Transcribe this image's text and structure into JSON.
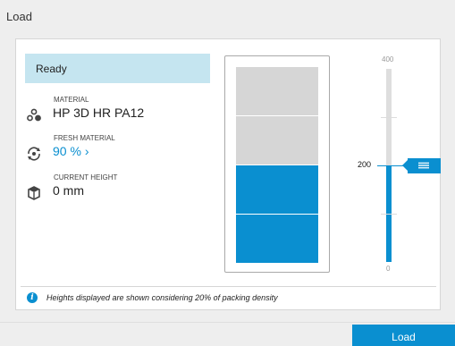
{
  "window": {
    "title": "Load"
  },
  "status": {
    "label": "Ready",
    "color": "#c5e5f0"
  },
  "material": {
    "label": "MATERIAL",
    "value": "HP 3D HR PA12",
    "icon": "material-icon"
  },
  "fresh_material": {
    "label": "FRESH MATERIAL",
    "value": "90 %",
    "chevron": "›",
    "icon": "fresh-material-icon"
  },
  "current_height": {
    "label": "CURRENT HEIGHT",
    "value": "0 mm",
    "icon": "box-icon"
  },
  "level": {
    "segments_total": 4,
    "segments_filled": 2,
    "filled_color": "#0a8fd0",
    "empty_color": "#d6d6d6"
  },
  "scale": {
    "min": 0,
    "max": 400,
    "current": 200,
    "max_label": "400",
    "min_label": "0",
    "current_label": "200",
    "tick_values": [
      100,
      200,
      300
    ]
  },
  "note": {
    "icon": "info-icon",
    "text": "Heights displayed are shown considering 20% of packing density"
  },
  "actions": {
    "load_label": "Load"
  },
  "colors": {
    "accent": "#0a8fd0",
    "background": "#eeeeee"
  }
}
